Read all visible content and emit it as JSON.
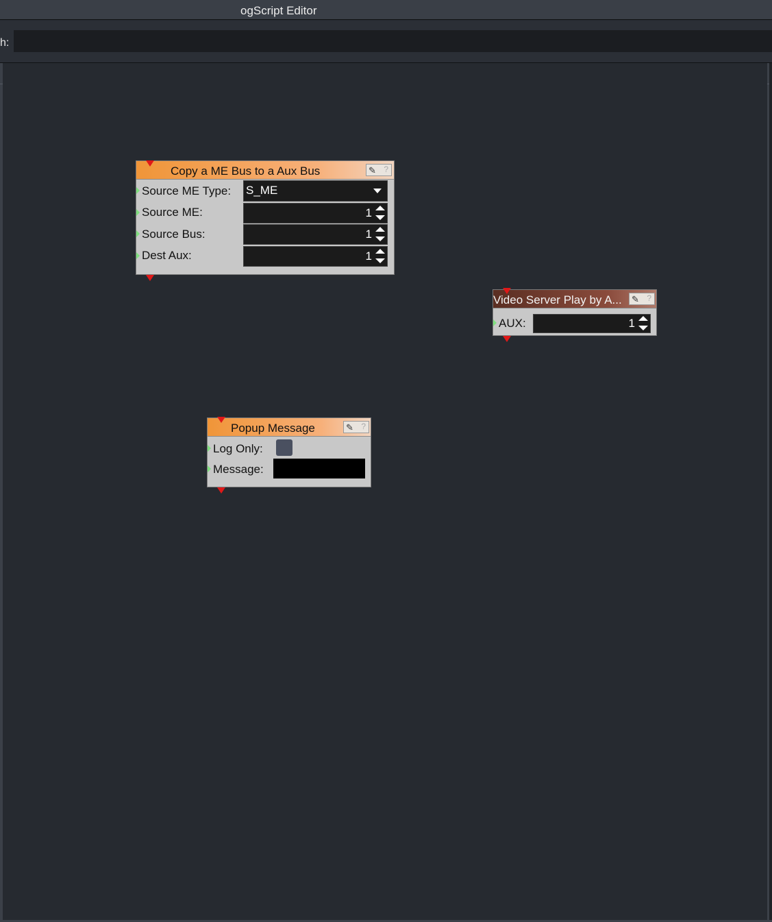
{
  "window": {
    "title": "ogScript Editor"
  },
  "search": {
    "label": "h:",
    "value": ""
  },
  "nodes": [
    {
      "title": "Copy a ME Bus to a Aux Bus",
      "fields": [
        {
          "label": "Source ME Type:",
          "value": "S_ME",
          "kind": "dropdown"
        },
        {
          "label": "Source ME:",
          "value": "1",
          "kind": "spinner"
        },
        {
          "label": "Source Bus:",
          "value": "1",
          "kind": "spinner"
        },
        {
          "label": "Dest Aux:",
          "value": "1",
          "kind": "spinner"
        }
      ]
    },
    {
      "title": "Video Server Play by A...",
      "fields": [
        {
          "label": "AUX:",
          "value": "1",
          "kind": "spinner"
        }
      ]
    },
    {
      "title": "Popup Message",
      "fields": [
        {
          "label": "Log Only:",
          "value": "",
          "kind": "checkbox",
          "checked": false
        },
        {
          "label": "Message:",
          "value": "",
          "kind": "text"
        }
      ]
    }
  ],
  "icons": {
    "edit": "edit-pencil-icon",
    "help": "help-icon"
  },
  "colors": {
    "canvas": "#262a30",
    "header_orange": "#f09538",
    "header_brown": "#5a2e22",
    "flow_arrow": "#e01818",
    "input_port": "#7fe07f"
  }
}
